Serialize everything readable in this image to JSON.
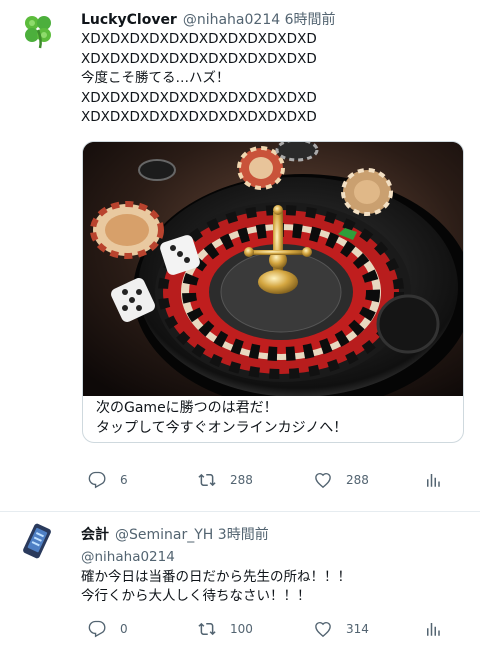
{
  "tweets": [
    {
      "name": "LuckyClover",
      "handle": "@nihaha0214",
      "time": "6時間前",
      "lines": [
        "XDXDXDXDXDXDXDXDXDXDXDXD",
        "XDXDXDXDXDXDXDXDXDXDXDXD",
        "今度こそ勝てる…ハズ！",
        "XDXDXDXDXDXDXDXDXDXDXDXD",
        "XDXDXDXDXDXDXDXDXDXDXDXD"
      ],
      "card": {
        "caption1": "次のGameに勝つのは君だ！",
        "caption2": "タップして今すぐオンラインカジノへ！"
      },
      "reply_count": "6",
      "retweet_count": "288",
      "like_count": "288",
      "icons": {
        "reply": "reply-icon",
        "retweet": "retweet-icon",
        "like": "heart-icon",
        "stats": "analytics-icon"
      }
    },
    {
      "name": "会計",
      "handle": "@Seminar_YH",
      "time": "3時間前",
      "reply_to": "@nihaha0214",
      "lines": [
        "確か今日は当番の日だから先生の所ね！！！",
        "今行くから大人しく待ちなさい！！！"
      ],
      "reply_count": "0",
      "retweet_count": "100",
      "like_count": "314"
    }
  ],
  "colors": {
    "secondary_text": "#536471",
    "border": "#e6ecf0",
    "clover_green": "#4caf3c"
  }
}
